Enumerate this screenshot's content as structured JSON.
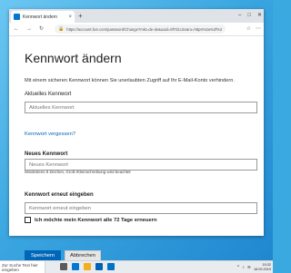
{
  "browser": {
    "tab_title": "Kennwort ändern",
    "tab_close": "×",
    "new_tab": "+",
    "url": "https://account.live.com/password/Change?mkt=de-de&uaid=9f7d1c2e&ru=https%3a%2f%2faccount.microsoft.com%2fprofile%2fpassword",
    "lock_glyph": "🔒",
    "back": "←",
    "forward": "→",
    "reload": "↻",
    "window_controls": [
      "–",
      "□",
      "✕"
    ],
    "toolbar_icons": [
      "☆",
      "⋯"
    ]
  },
  "page": {
    "heading": "Kennwort ändern",
    "description": "Mit einem sicheren Kennwort können Sie unerlaubten Zugriff auf Ihr E-Mail-Konto verhindern.",
    "current_password": {
      "label": "Aktuelles Kennwort",
      "placeholder": "Aktuelles Kennwort",
      "value": ""
    },
    "forgot_link": "Kennwort vergessen?",
    "new_password": {
      "label": "Neues Kennwort",
      "placeholder": "Neues Kennwort",
      "value": "",
      "hint": "Mindestens 8 Zeichen, Groß-/Kleinschreibung wird beachtet"
    },
    "confirm_password": {
      "label": "Kennwort erneut eingeben",
      "placeholder": "Kennwort erneut eingeben",
      "value": ""
    },
    "checkbox": {
      "label": "Ich möchte mein Kennwort alle 72 Tage erneuern",
      "checked": false
    },
    "save_button": "Speichern",
    "cancel_button": "Abbrechen"
  },
  "taskbar": {
    "search_text": "Zur Suche Text hier eingeben",
    "tray_icons": [
      "^",
      "♪",
      "≋"
    ],
    "time": "15:32",
    "date": "18.09.2019"
  },
  "colors": {
    "accent": "#0067b8",
    "link": "#0067b8",
    "desktop": "#3aa6e0"
  }
}
